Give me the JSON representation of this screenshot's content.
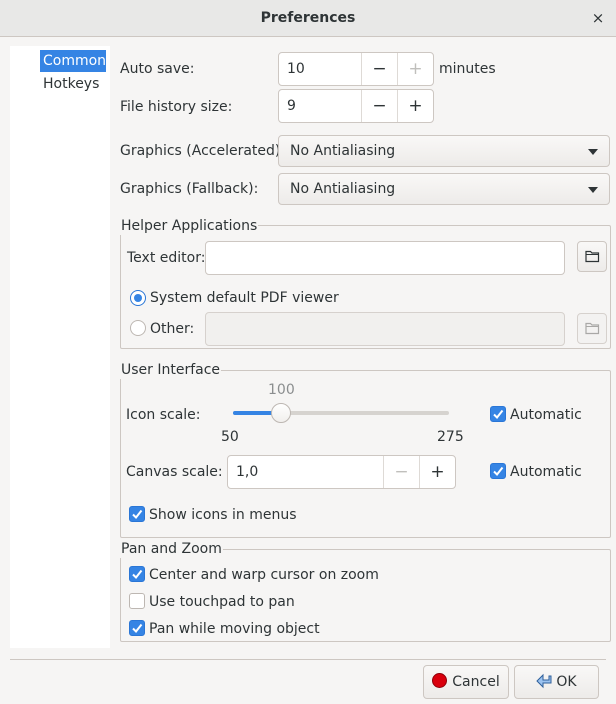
{
  "window": {
    "title": "Preferences",
    "close_glyph": "×"
  },
  "sidebar": {
    "items": [
      {
        "label": "Common",
        "selected": true
      },
      {
        "label": "Hotkeys",
        "selected": false
      }
    ]
  },
  "autosave": {
    "label": "Auto save:",
    "value": "10",
    "unit": "minutes",
    "minus": "−",
    "plus": "+"
  },
  "history": {
    "label": "File history size:",
    "value": "9",
    "minus": "−",
    "plus": "+"
  },
  "graphics_accel": {
    "label": "Graphics (Accelerated):",
    "value": "No Antialiasing"
  },
  "graphics_fallback": {
    "label": "Graphics (Fallback):",
    "value": "No Antialiasing"
  },
  "helper": {
    "title": "Helper Applications",
    "text_editor_label": "Text editor:",
    "text_editor_value": "",
    "pdf_default_label": "System default PDF viewer",
    "pdf_other_label": "Other:",
    "pdf_other_value": ""
  },
  "ui": {
    "title": "User Interface",
    "icon_scale_label": "Icon scale:",
    "slider_value": "100",
    "slider_min": "50",
    "slider_max": "275",
    "slider_fraction": 0.222,
    "icon_auto_label": "Automatic",
    "canvas_scale_label": "Canvas scale:",
    "canvas_scale_value": "1,0",
    "canvas_minus": "−",
    "canvas_plus": "+",
    "canvas_auto_label": "Automatic",
    "show_icons_label": "Show icons in menus"
  },
  "pan": {
    "title": "Pan and Zoom",
    "center_label": "Center and warp cursor on zoom",
    "touchpad_label": "Use touchpad to pan",
    "pan_move_label": "Pan while moving object"
  },
  "buttons": {
    "cancel": "Cancel",
    "ok": "OK"
  },
  "colors": {
    "accent": "#3584e4",
    "background": "#f6f5f4",
    "cancel_icon": "#d9000d"
  },
  "icons": {
    "folder": "folder-icon",
    "cancel": "cancel-icon",
    "ok": "ok-arrow-icon",
    "check": "check-icon"
  }
}
